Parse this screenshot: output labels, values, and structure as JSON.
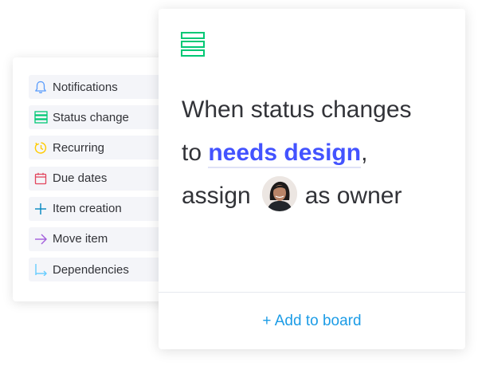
{
  "triggers": [
    {
      "label": "Notifications",
      "icon": "bell-icon",
      "color": "#579bfc"
    },
    {
      "label": "Status change",
      "icon": "status-bars-icon",
      "color": "#00c875"
    },
    {
      "label": "Recurring",
      "icon": "clock-refresh-icon",
      "color": "#ffcb00"
    },
    {
      "label": "Due dates",
      "icon": "calendar-icon",
      "color": "#e2445c"
    },
    {
      "label": "Item creation",
      "icon": "plus-icon",
      "color": "#0086c0"
    },
    {
      "label": "Move item",
      "icon": "arrow-right-icon",
      "color": "#a25ddc"
    },
    {
      "label": "Dependencies",
      "icon": "dependency-icon",
      "color": "#66ccff"
    }
  ],
  "recipe": {
    "line1": "When status changes",
    "line2_prefix": "to ",
    "status_value": "needs design",
    "line2_suffix": ",",
    "line3_prefix": "assign",
    "line3_suffix": "as owner",
    "status_icon_color": "#00c875",
    "highlight_color": "#4353ff"
  },
  "footer": {
    "add_label": "+ Add to board",
    "color": "#1c9ce6"
  }
}
